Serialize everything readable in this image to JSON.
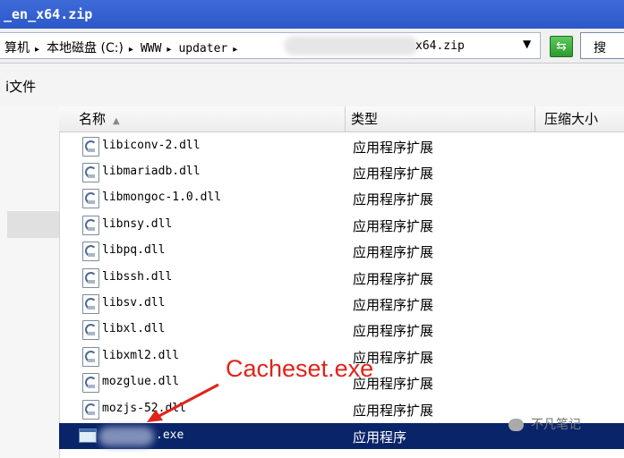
{
  "window": {
    "title": "_en_x64.zip"
  },
  "address": {
    "crumbs": [
      "算机",
      "本地磁盘 (C:)",
      "WWW",
      "updater"
    ],
    "last": "x64.zip"
  },
  "search": {
    "label": "搜"
  },
  "toolbar": {
    "label": "i文件"
  },
  "columns": {
    "name": "名称",
    "type": "类型",
    "size": "压缩大小"
  },
  "files": [
    {
      "name": "libiconv-2.dll",
      "type": "应用程序扩展"
    },
    {
      "name": "libmariadb.dll",
      "type": "应用程序扩展"
    },
    {
      "name": "libmongoc-1.0.dll",
      "type": "应用程序扩展"
    },
    {
      "name": "libnsy.dll",
      "type": "应用程序扩展"
    },
    {
      "name": "libpq.dll",
      "type": "应用程序扩展"
    },
    {
      "name": "libssh.dll",
      "type": "应用程序扩展"
    },
    {
      "name": "libsv.dll",
      "type": "应用程序扩展"
    },
    {
      "name": "libxl.dll",
      "type": "应用程序扩展"
    },
    {
      "name": "libxml2.dll",
      "type": "应用程序扩展"
    },
    {
      "name": "mozglue.dll",
      "type": "应用程序扩展"
    },
    {
      "name": "mozjs-52.dll",
      "type": "应用程序扩展"
    }
  ],
  "selected_file": {
    "suffix": ".exe",
    "type": "应用程序"
  },
  "annotation": {
    "text": "Cacheset.exe",
    "color": "#e0231b"
  },
  "watermark": {
    "text": "不凡笔记"
  },
  "icons": [
    "dll-file-icon",
    "exe-file-icon",
    "go-arrow-icon",
    "sort-ascending-icon",
    "chevron-down-icon"
  ]
}
